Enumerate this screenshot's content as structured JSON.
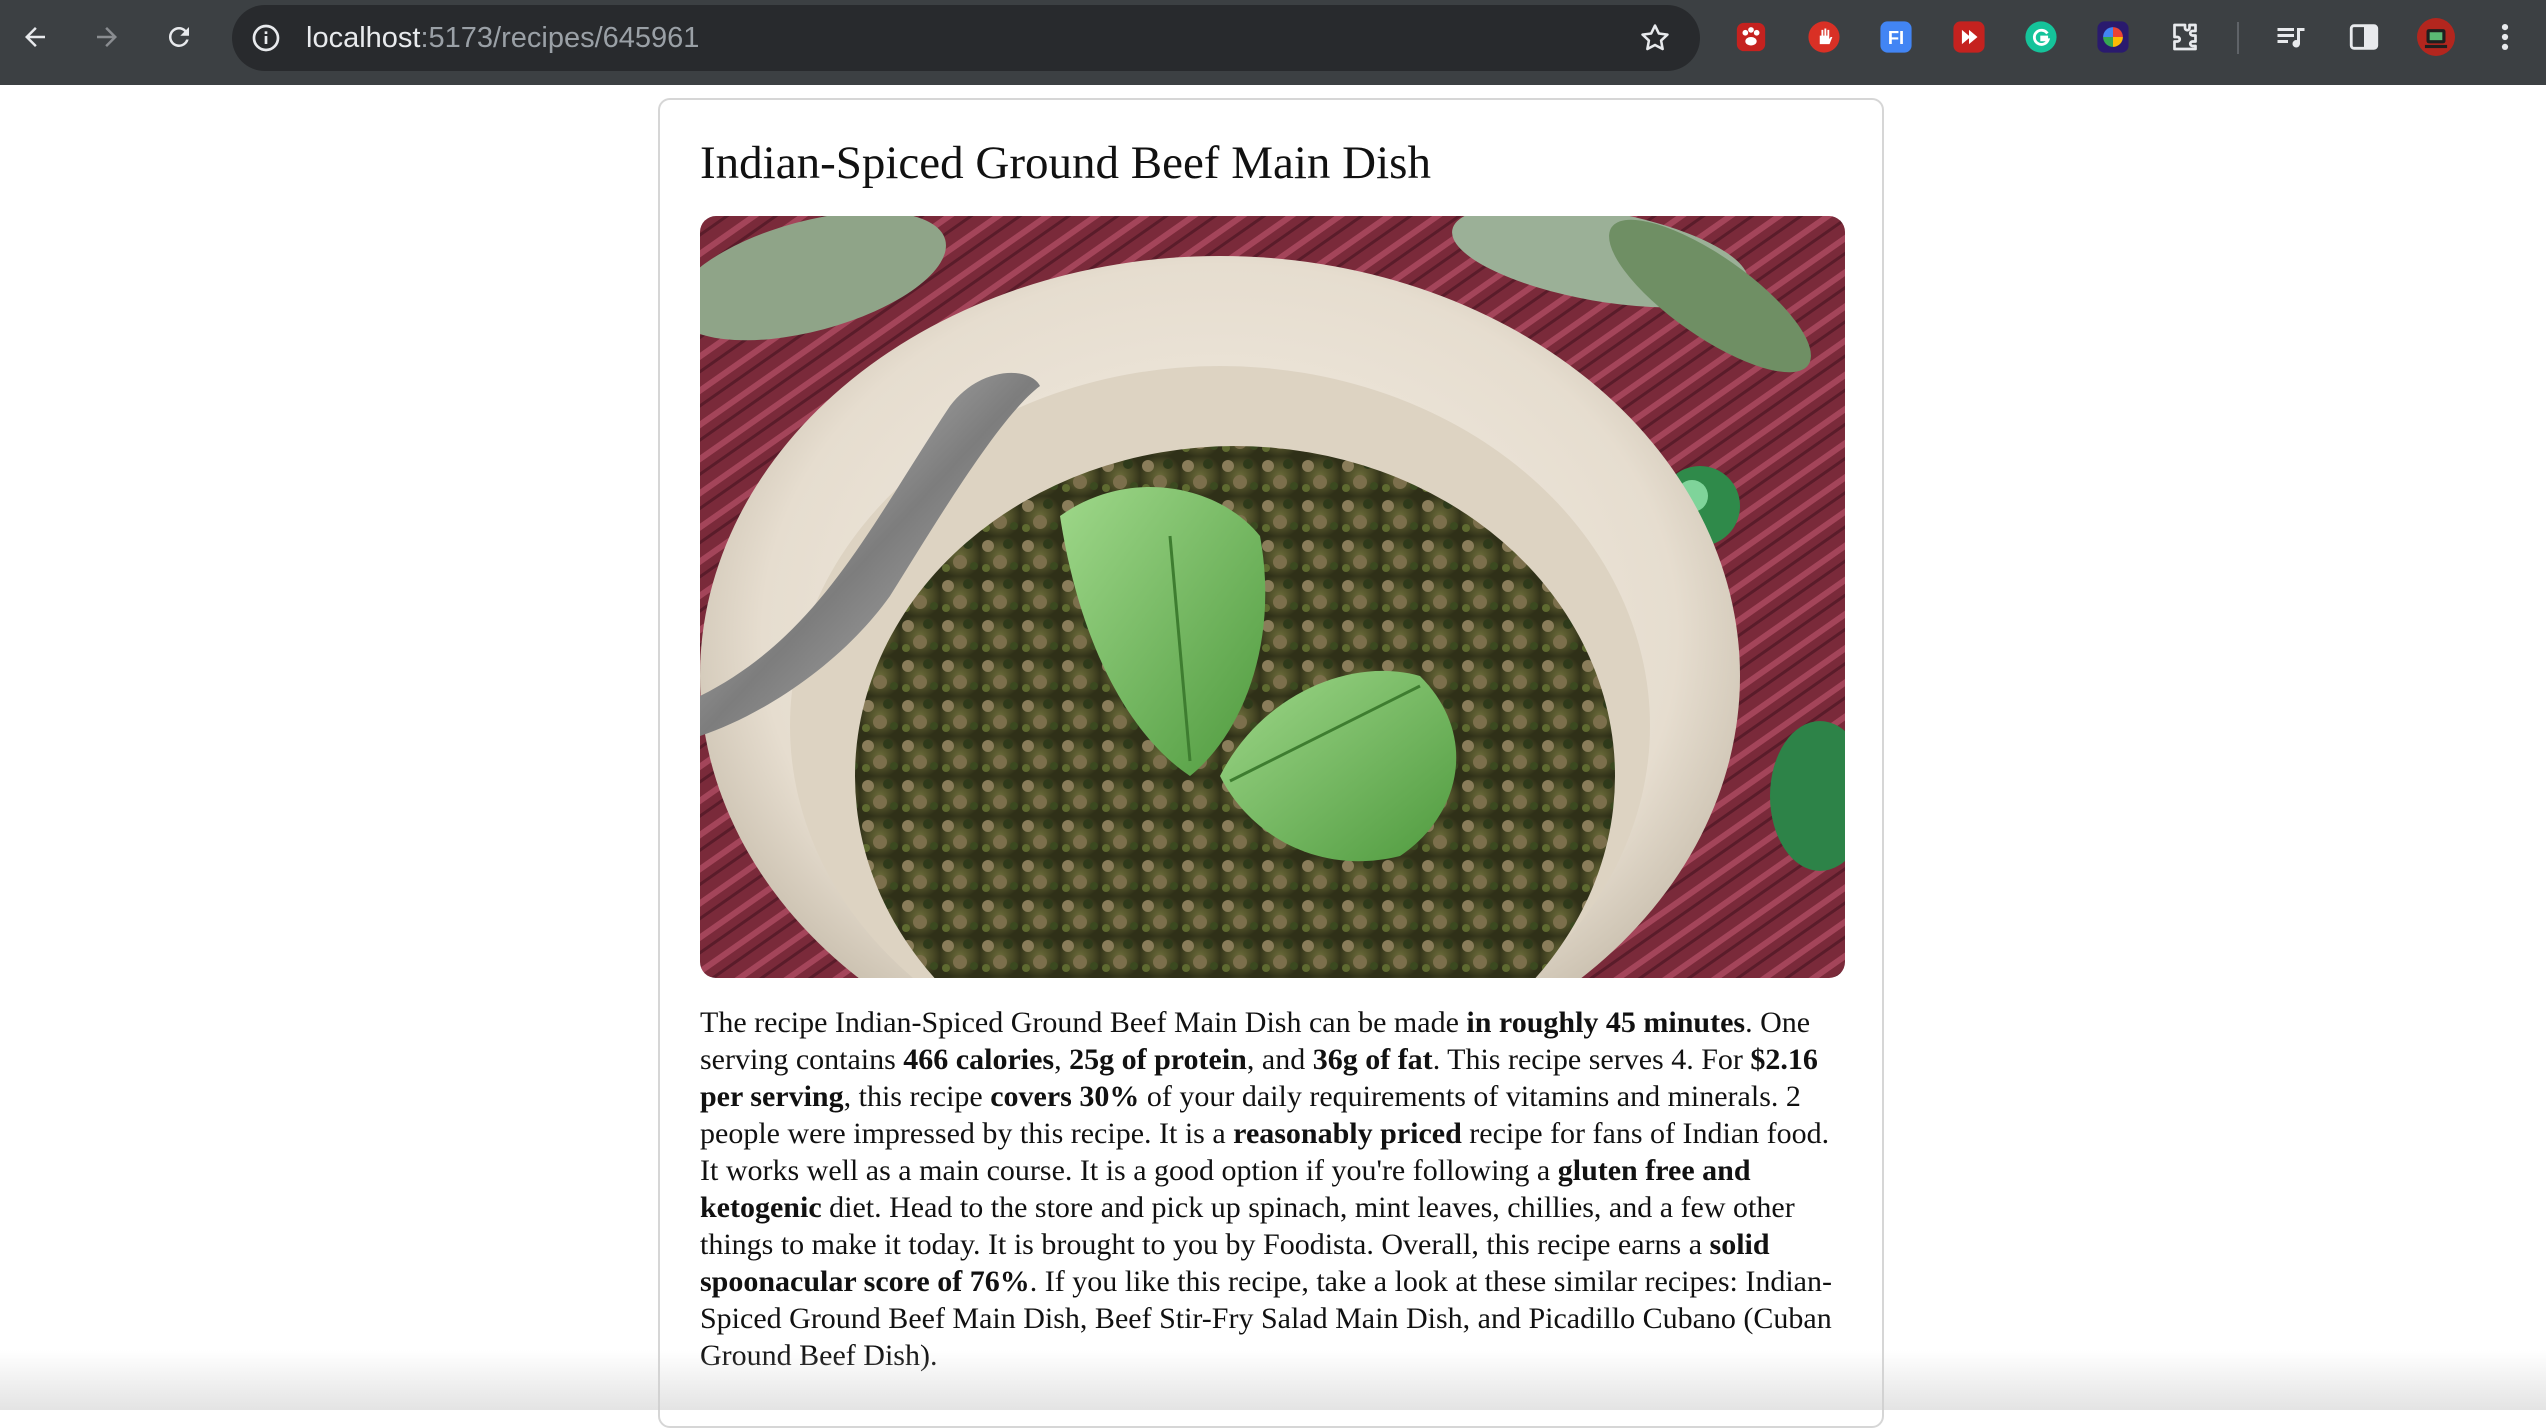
{
  "browser": {
    "url_host": "localhost",
    "url_path": ":5173/recipes/645961",
    "icons": {
      "back": "arrow-left-icon",
      "forward": "arrow-right-icon",
      "reload": "reload-icon",
      "info": "info-circle-icon",
      "bookmark": "star-icon",
      "extensions": "puzzle-icon",
      "media": "media-queue-icon",
      "side_panel": "side-panel-icon",
      "menu": "vertical-dots-icon"
    },
    "extensions": [
      {
        "name": "paw-extension-icon",
        "color": "#c5221f",
        "glyph": "🐾"
      },
      {
        "name": "hand-extension-icon",
        "color": "#d93025",
        "glyph": "✋"
      },
      {
        "name": "fi-extension-icon",
        "color": "#4285f4",
        "glyph": "FI"
      },
      {
        "name": "play-extension-icon",
        "color": "#c5221f",
        "glyph": "▶"
      },
      {
        "name": "grammarly-extension-icon",
        "color": "#15c39a",
        "glyph": "G"
      },
      {
        "name": "color-wheel-extension-icon",
        "color": "#3c1e9a",
        "glyph": "◉"
      }
    ]
  },
  "recipe": {
    "title": "Indian-Spiced Ground Beef Main Dish",
    "summary": [
      {
        "t": "The recipe Indian-Spiced Ground Beef Main Dish can be made ",
        "b": false
      },
      {
        "t": "in roughly 45 minutes",
        "b": true
      },
      {
        "t": ". One serving contains ",
        "b": false
      },
      {
        "t": "466 calories",
        "b": true
      },
      {
        "t": ", ",
        "b": false
      },
      {
        "t": "25g of protein",
        "b": true
      },
      {
        "t": ", and ",
        "b": false
      },
      {
        "t": "36g of fat",
        "b": true
      },
      {
        "t": ". This recipe serves 4. For ",
        "b": false
      },
      {
        "t": "$2.16 per serving",
        "b": true
      },
      {
        "t": ", this recipe ",
        "b": false
      },
      {
        "t": "covers 30%",
        "b": true
      },
      {
        "t": " of your daily requirements of vitamins and minerals. 2 people were impressed by this recipe. It is a ",
        "b": false
      },
      {
        "t": "reasonably priced",
        "b": true
      },
      {
        "t": " recipe for fans of Indian food. It works well as a main course. It is a good option if you're following a ",
        "b": false
      },
      {
        "t": "gluten free and ketogenic",
        "b": true
      },
      {
        "t": " diet. Head to the store and pick up spinach, mint leaves, chillies, and a few other things to make it today. It is brought to you by Foodista. Overall, this recipe earns a ",
        "b": false
      },
      {
        "t": "solid spoonacular score of 76%",
        "b": true
      },
      {
        "t": ". If you like this recipe, take a look at these similar recipes: Indian-Spiced Ground Beef Main Dish, Beef Stir-Fry Salad Main Dish, and Picadillo Cubano (Cuban Ground Beef Dish).",
        "b": false
      }
    ]
  },
  "colors": {
    "chrome_bg": "#3c4043",
    "omnibox_bg": "#282a2d",
    "text": "#111111",
    "card_border": "#d6d6d6"
  }
}
